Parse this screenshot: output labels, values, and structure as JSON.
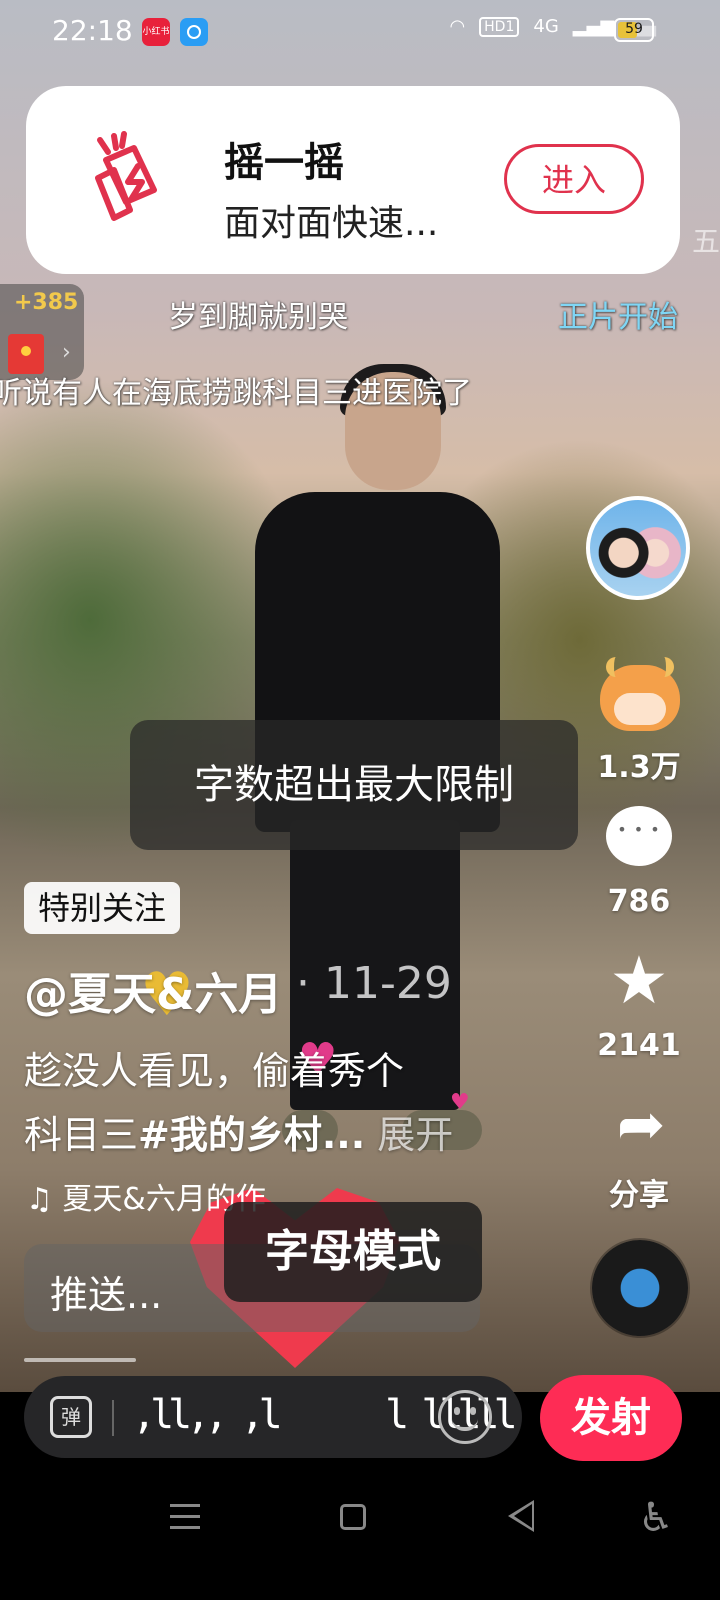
{
  "status_bar": {
    "time": "22:18",
    "app_icon_1": "小红书",
    "hd": "HD1",
    "network": "4G",
    "battery": "59",
    "battery_level": 0.59
  },
  "shake_card": {
    "title": "摇一摇",
    "subtitle": "面对面快速...",
    "enter_label": "进入"
  },
  "edge_char": "五",
  "red_packet": {
    "count": "+385",
    "arrow": "›"
  },
  "danmaku": [
    "岁到脚就别哭",
    "正片开始",
    "听说有人在海底捞跳科目三进医院了"
  ],
  "side_actions": {
    "like_count": "1.3万",
    "comment_count": "786",
    "favorite_count": "2141",
    "share_label": "分享"
  },
  "toast_limit": "字数超出最大限制",
  "special_follow": "特别关注",
  "author": "@夏天&六月",
  "date": "· 11-29",
  "description_line1": "趁没人看见，偷着秀个",
  "description_line2_text": "科目三",
  "description_line2_tag": "#我的乡村...",
  "description_more": "展开",
  "music": "♫ 夏天&六月的作",
  "push_label": "推送...",
  "toast_mode": "字母模式",
  "input": {
    "toggle_label": "弹",
    "text": ",ll,, ,l      l lllll",
    "send_label": "发射"
  },
  "colors": {
    "accent": "#fe2c55",
    "card_accent": "#e0324d"
  }
}
